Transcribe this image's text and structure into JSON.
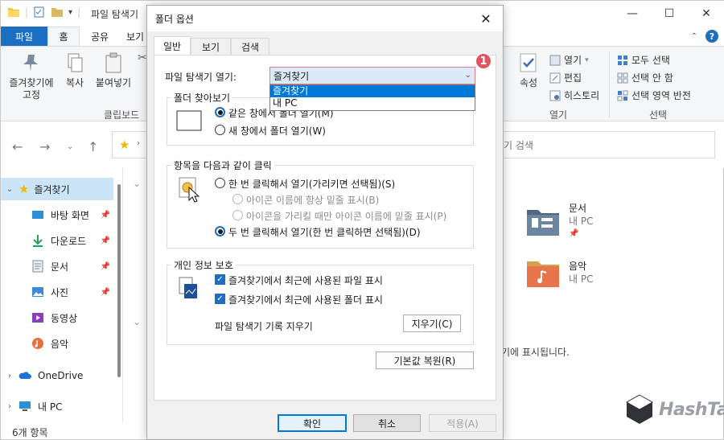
{
  "explorer": {
    "title": "파일 탐색기",
    "ribbon_tabs": {
      "file": "파일",
      "home": "홈",
      "share": "공유",
      "view": "보기"
    },
    "ribbon": {
      "pin": "즐겨찾기에\n고정",
      "copy": "복사",
      "paste": "붙여넣기",
      "clipboard_group": "클립보드",
      "properties": "속성",
      "open": "열기",
      "edit": "편집",
      "history": "히스토리",
      "open_group": "열기",
      "select_all": "모두 선택",
      "select_none": "선택 안 함",
      "invert_selection": "선택 영역 반전",
      "select_group": "선택"
    },
    "search_placeholder": "기 검색",
    "nav": {
      "favorites": "즐겨찾기",
      "desktop": "바탕 화면",
      "downloads": "다운로드",
      "documents": "문서",
      "pictures": "사진",
      "videos": "동영상",
      "music": "음악",
      "onedrive": "OneDrive",
      "thispc": "내 PC"
    },
    "status": "6개 항목",
    "content": {
      "documents_title": "문서",
      "documents_sub": "내 PC",
      "music_title": "음악",
      "music_sub": "내 PC",
      "note": "기에 표시됩니다."
    },
    "watermark": "HashTag"
  },
  "dialog": {
    "title": "폴더 옵션",
    "tabs": [
      "일반",
      "보기",
      "검색"
    ],
    "open_explorer_label": "파일 탐색기 열기:",
    "open_explorer_value": "즐겨찾기",
    "dropdown_options": [
      "즐겨찾기",
      "내 PC"
    ],
    "badge": "1",
    "browse_group": "폴더 찾아보기",
    "browse_same": "같은 창에서 폴더 열기(M)",
    "browse_new": "새 창에서 폴더 열기(W)",
    "click_group": "항목을 다음과 같이 클릭",
    "single_click": "한 번 클릭해서 열기(가리키면 선택됨)(S)",
    "underline_always": "아이콘 이름에 항상 밑줄 표시(B)",
    "underline_hover": "아이콘을 가리킬 때만 아이콘 이름에 밑줄 표시(P)",
    "double_click": "두 번 클릭해서 열기(한 번 클릭하면 선택됨)(D)",
    "privacy_group": "개인 정보 보호",
    "show_recent_files": "즐겨찾기에서 최근에 사용된 파일 표시",
    "show_frequent_folders": "즐겨찾기에서 최근에 사용된 폴더 표시",
    "clear_history_label": "파일 탐색기 기록 지우기",
    "clear_button": "지우기(C)",
    "restore_defaults": "기본값 복원(R)",
    "ok": "확인",
    "cancel": "취소",
    "apply": "적용(A)"
  }
}
